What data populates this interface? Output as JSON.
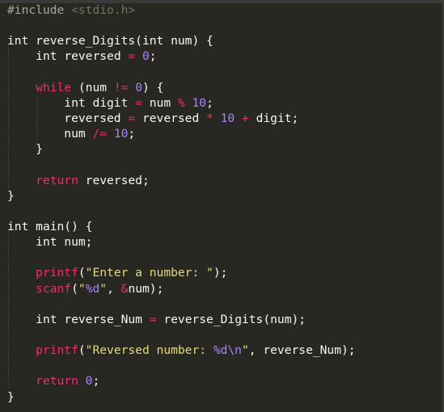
{
  "editor": {
    "theme": {
      "background": "#272822",
      "text": "#f8f8f2",
      "keyword": "#f92672",
      "number": "#ae81ff",
      "string": "#e6db74",
      "preprocessor": "#a6a6a6"
    },
    "lines": [
      [
        {
          "t": "pre",
          "v": "#include "
        },
        {
          "t": "inc",
          "v": "<stdio.h>"
        }
      ],
      [],
      [
        {
          "t": "type",
          "v": "int "
        },
        {
          "t": "plain",
          "v": "reverse_Digits(int num) {"
        }
      ],
      [
        {
          "t": "plain",
          "v": "    "
        },
        {
          "t": "type",
          "v": "int "
        },
        {
          "t": "plain",
          "v": "reversed "
        },
        {
          "t": "op",
          "v": "="
        },
        {
          "t": "plain",
          "v": " "
        },
        {
          "t": "num",
          "v": "0"
        },
        {
          "t": "plain",
          "v": ";"
        }
      ],
      [],
      [
        {
          "t": "plain",
          "v": "    "
        },
        {
          "t": "ctl",
          "v": "while"
        },
        {
          "t": "plain",
          "v": " (num "
        },
        {
          "t": "op",
          "v": "!="
        },
        {
          "t": "plain",
          "v": " "
        },
        {
          "t": "num",
          "v": "0"
        },
        {
          "t": "plain",
          "v": ") {"
        }
      ],
      [
        {
          "t": "plain",
          "v": "        "
        },
        {
          "t": "type",
          "v": "int "
        },
        {
          "t": "plain",
          "v": "digit "
        },
        {
          "t": "op",
          "v": "="
        },
        {
          "t": "plain",
          "v": " num "
        },
        {
          "t": "op",
          "v": "%"
        },
        {
          "t": "plain",
          "v": " "
        },
        {
          "t": "num",
          "v": "10"
        },
        {
          "t": "plain",
          "v": ";"
        }
      ],
      [
        {
          "t": "plain",
          "v": "        reversed "
        },
        {
          "t": "op",
          "v": "="
        },
        {
          "t": "plain",
          "v": " reversed "
        },
        {
          "t": "op",
          "v": "*"
        },
        {
          "t": "plain",
          "v": " "
        },
        {
          "t": "num",
          "v": "10"
        },
        {
          "t": "plain",
          "v": " "
        },
        {
          "t": "op",
          "v": "+"
        },
        {
          "t": "plain",
          "v": " digit;"
        }
      ],
      [
        {
          "t": "plain",
          "v": "        num "
        },
        {
          "t": "op",
          "v": "/="
        },
        {
          "t": "plain",
          "v": " "
        },
        {
          "t": "num",
          "v": "10"
        },
        {
          "t": "plain",
          "v": ";"
        }
      ],
      [
        {
          "t": "plain",
          "v": "    }"
        }
      ],
      [],
      [
        {
          "t": "plain",
          "v": "    "
        },
        {
          "t": "ctl",
          "v": "return"
        },
        {
          "t": "plain",
          "v": " reversed;"
        }
      ],
      [
        {
          "t": "plain",
          "v": "}"
        }
      ],
      [],
      [
        {
          "t": "type",
          "v": "int "
        },
        {
          "t": "plain",
          "v": "main() {"
        }
      ],
      [
        {
          "t": "plain",
          "v": "    "
        },
        {
          "t": "type",
          "v": "int "
        },
        {
          "t": "plain",
          "v": "num;"
        }
      ],
      [],
      [
        {
          "t": "plain",
          "v": "    "
        },
        {
          "t": "fn",
          "v": "printf"
        },
        {
          "t": "plain",
          "v": "("
        },
        {
          "t": "str",
          "v": "\"Enter a number: \""
        },
        {
          "t": "plain",
          "v": ");"
        }
      ],
      [
        {
          "t": "plain",
          "v": "    "
        },
        {
          "t": "fn",
          "v": "scanf"
        },
        {
          "t": "plain",
          "v": "("
        },
        {
          "t": "str",
          "v": "\""
        },
        {
          "t": "esc",
          "v": "%d"
        },
        {
          "t": "str",
          "v": "\""
        },
        {
          "t": "plain",
          "v": ", "
        },
        {
          "t": "op",
          "v": "&"
        },
        {
          "t": "plain",
          "v": "num);"
        }
      ],
      [],
      [
        {
          "t": "plain",
          "v": "    "
        },
        {
          "t": "type",
          "v": "int "
        },
        {
          "t": "plain",
          "v": "reverse_Num "
        },
        {
          "t": "op",
          "v": "="
        },
        {
          "t": "plain",
          "v": " reverse_Digits(num);"
        }
      ],
      [],
      [
        {
          "t": "plain",
          "v": "    "
        },
        {
          "t": "fn",
          "v": "printf"
        },
        {
          "t": "plain",
          "v": "("
        },
        {
          "t": "str",
          "v": "\"Reversed number: "
        },
        {
          "t": "esc",
          "v": "%d\\n"
        },
        {
          "t": "str",
          "v": "\""
        },
        {
          "t": "plain",
          "v": ", reverse_Num);"
        }
      ],
      [],
      [
        {
          "t": "plain",
          "v": "    "
        },
        {
          "t": "ctl",
          "v": "return"
        },
        {
          "t": "plain",
          "v": " "
        },
        {
          "t": "num",
          "v": "0"
        },
        {
          "t": "plain",
          "v": ";"
        }
      ],
      [
        {
          "t": "plain",
          "v": "}"
        }
      ]
    ]
  }
}
